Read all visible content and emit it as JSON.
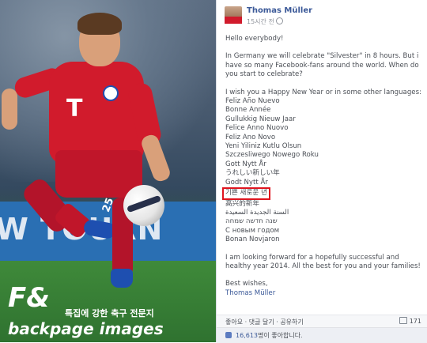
{
  "photo": {
    "ad_text": "W TOURN",
    "shirt_logo": "T",
    "shirt_number": "25",
    "watermark": {
      "brand_mark": "F&",
      "tagline": "특집에 강한 축구 전문지",
      "brand_name": "backpage images"
    }
  },
  "post": {
    "author": "Thomas Müller",
    "timestamp": "15시간 전",
    "paragraphs": [
      "Hello everybody!",
      "In Germany we will celebrate \"Silvester\" in 8 hours. But i have so many Facebook-fans around the world. When do you start to celebrate?"
    ],
    "intro_line": "I wish you a Happy New Year or in some other languages:",
    "greetings_before": [
      "Feliz Año Nuevo",
      "Bonne Année",
      "Gullukkig Nieuw Jaar",
      "Felice Anno Nuovo",
      "Feliz Ano Novo",
      "Yeni Yiliniz Kutlu Olsun",
      "Szczesliwego Nowego Roku",
      "Gott Nytt År",
      "うれしい新しい年",
      "Godt Nytt År"
    ],
    "highlighted_greeting": "기쁜 새로운 년",
    "greetings_after": [
      "高兴的新年",
      "السنة الجديدة السعيدة",
      "שנה חדשה שמחה",
      "С новым годом",
      "Bonan Novjaron"
    ],
    "closing_paragraph": "I am looking forward for a hopefully successful and healthy year 2014. All the best for you and your families!",
    "sign_off": "Best wishes,",
    "signature": "Thomas Müller"
  },
  "actions": {
    "links": "좋아요 · 댓글 달기 · 공유하기",
    "share_count": "171"
  },
  "likes": {
    "count": "16,613",
    "suffix": "명이 좋아합니다."
  },
  "colors": {
    "link_blue": "#3b5998",
    "highlight_red": "#e0141e",
    "jersey_red": "#d11b2c"
  }
}
